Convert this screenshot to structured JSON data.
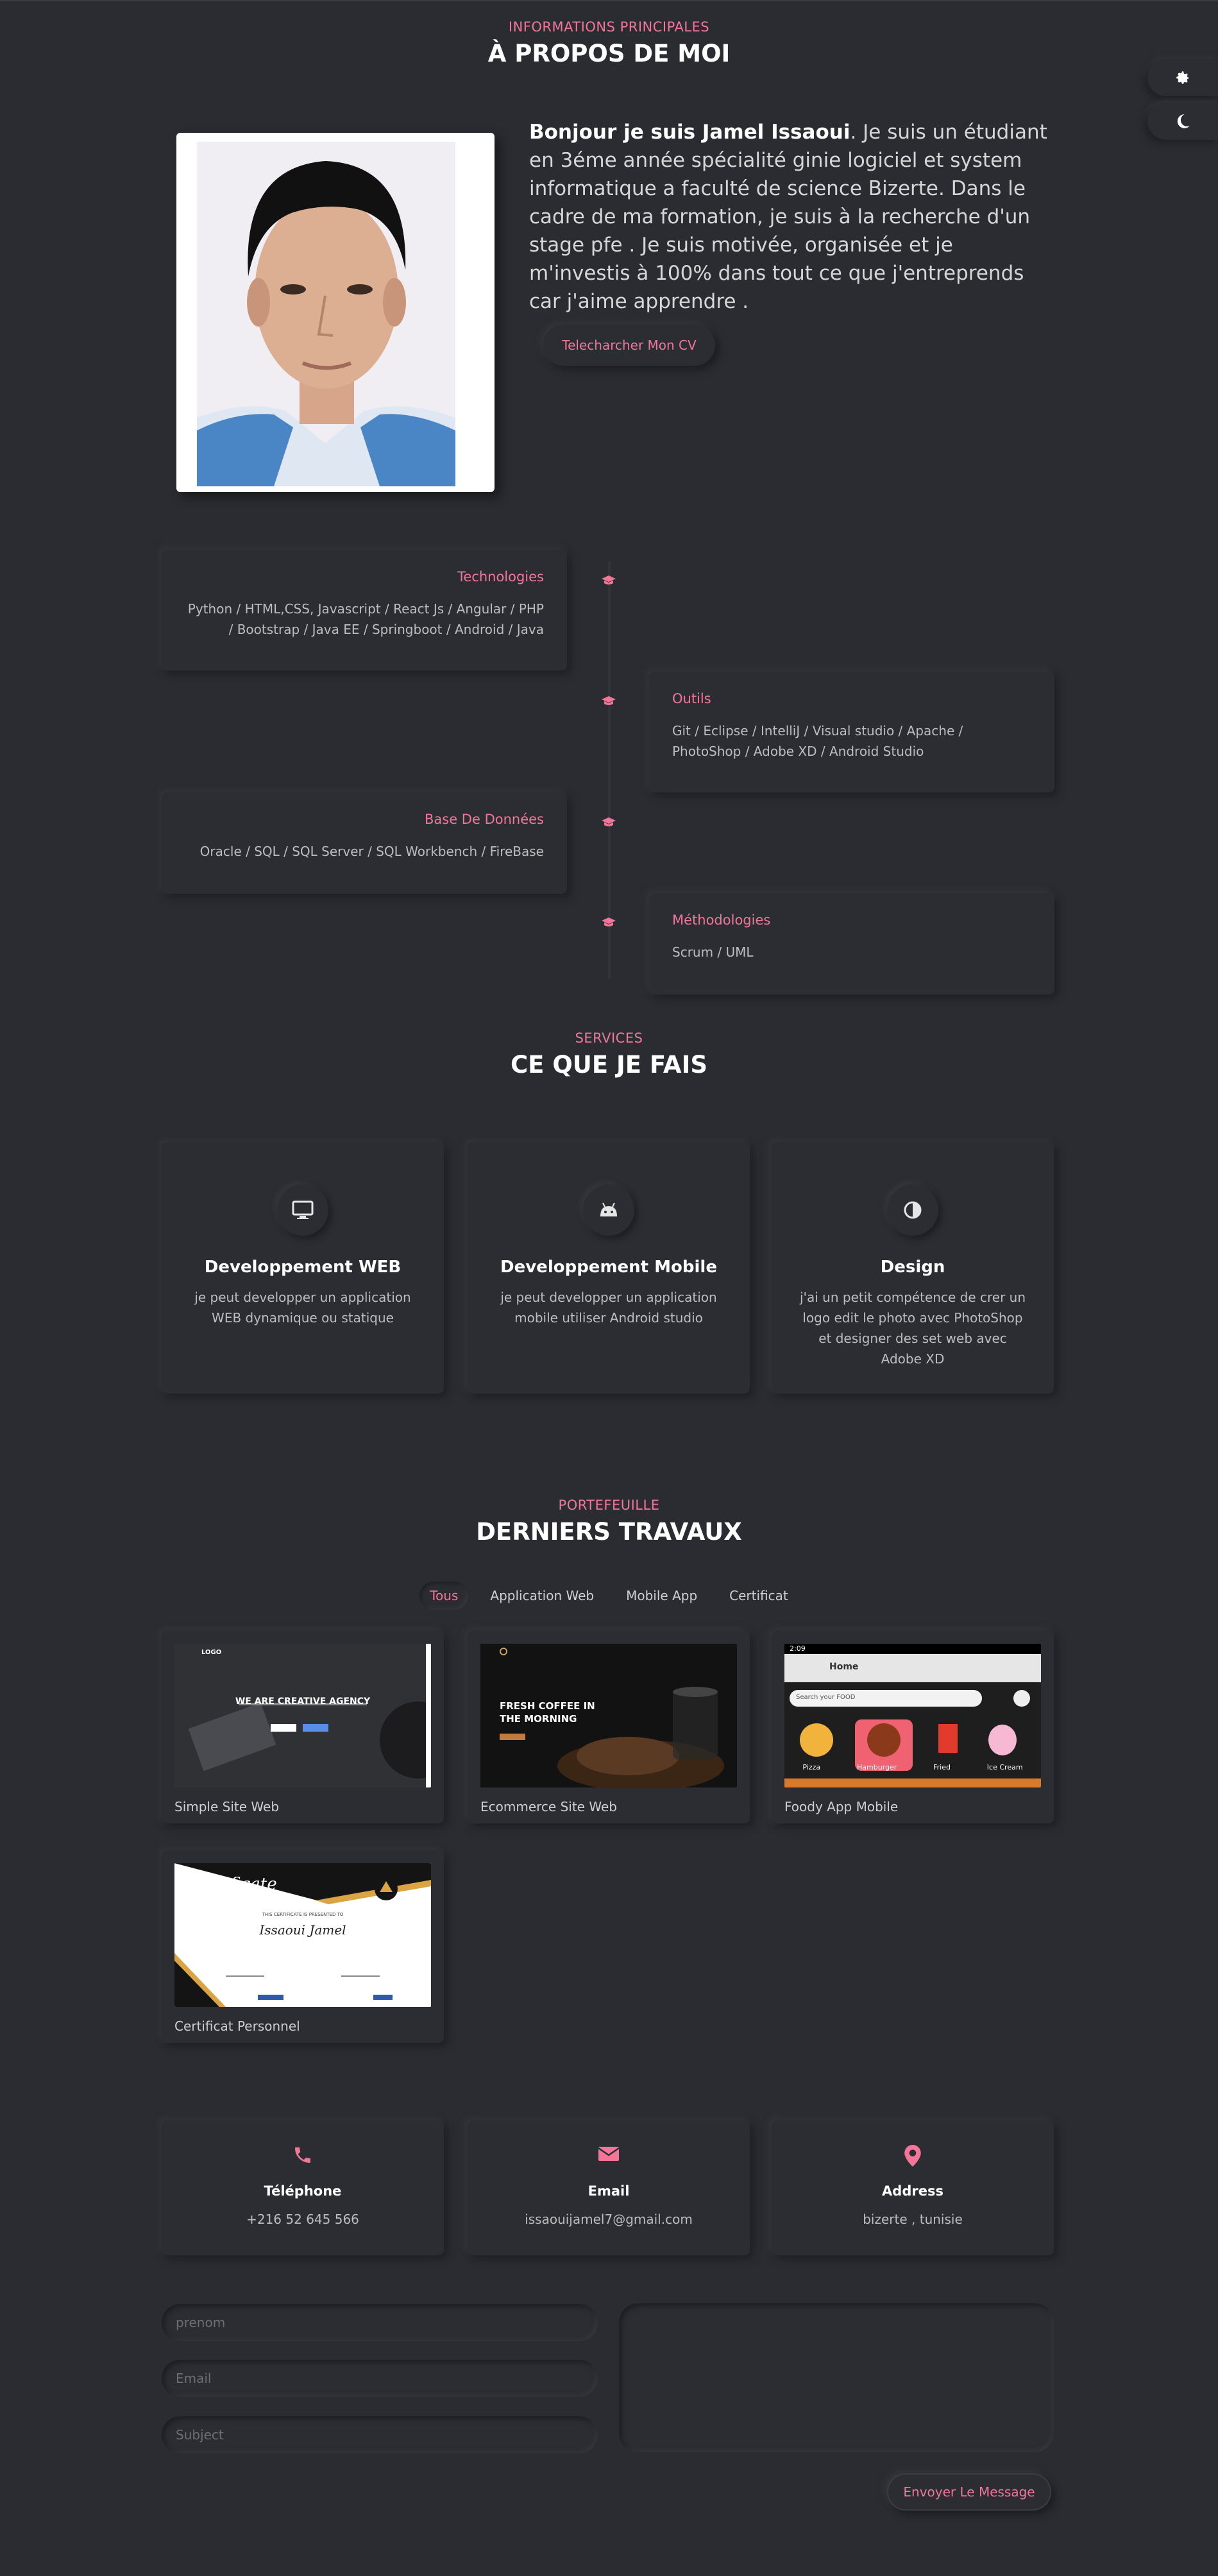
{
  "colors": {
    "accent": "#f27698",
    "background": "#2a2c31"
  },
  "side_buttons": {
    "settings_icon": "gear-icon",
    "theme_icon": "moon-icon"
  },
  "about": {
    "subtitle": "INFORMATIONS PRINCIPALES",
    "title": "À PROPOS DE MOI",
    "intro_bold": "Bonjour je suis Jamel Issaoui",
    "intro_rest": ". Je suis un étudiant en 3éme année spécialité ginie logiciel et system informatique a faculté de science Bizerte. Dans le cadre de ma formation, je suis à la recherche d'un stage pfe . Je suis motivée, organisée et je m'investis à 100% dans tout ce que j'entreprends car j'aime apprendre .",
    "cv_button": "Telecharcher Mon CV"
  },
  "skills": [
    {
      "title": "Technologies",
      "text": "Python / HTML,CSS, Javascript / React Js / Angular / PHP / Bootstrap / Java EE / Springboot / Android / Java"
    },
    {
      "title": "Outils",
      "text": "Git / Eclipse / IntelliJ / Visual studio / Apache / PhotoShop / Adobe XD / Android Studio"
    },
    {
      "title": "Base De Données",
      "text": "Oracle / SQL / SQL Server / SQL Workbench / FireBase"
    },
    {
      "title": "Méthodologies",
      "text": "Scrum / UML"
    }
  ],
  "services": {
    "subtitle": "SERVICES",
    "title": "CE QUE JE FAIS",
    "items": [
      {
        "title": "Developpement WEB",
        "text": "je peut developper un application WEB dynamique ou statique",
        "icon": "monitor-icon"
      },
      {
        "title": "Developpement Mobile",
        "text": "je peut developper un application mobile utiliser Android studio",
        "icon": "android-icon"
      },
      {
        "title": "Design",
        "text": "j'ai un petit compétence de crer un logo edit le photo avec PhotoShop et designer des set web avec Adobe XD",
        "icon": "contrast-icon"
      }
    ]
  },
  "portfolio": {
    "subtitle": "PORTEFEUILLE",
    "title": "DERNIERS TRAVAUX",
    "filters": [
      "Tous",
      "Application Web",
      "Mobile App",
      "Certificat"
    ],
    "works": [
      {
        "label": "Simple Site Web",
        "thumb": {
          "logo": "LOGO",
          "headline": "WE ARE CREATIVE AGENCY"
        }
      },
      {
        "label": "Ecommerce Site Web",
        "thumb": {
          "headline_1": "FRESH COFFEE IN",
          "headline_2": "THE MORNING"
        }
      },
      {
        "label": "Foody App Mobile",
        "thumb": {
          "time": "2:09",
          "bar_title": "Home",
          "search": "Search your FOOD",
          "categories": [
            "Pizza",
            "Hamburger",
            "Fried",
            "Ice Cream"
          ]
        }
      },
      {
        "label": "Certificat Personnel",
        "thumb": {
          "heading": "Certificate",
          "line": "THIS CERTIFICATE IS PRESENTED TO",
          "name": "Issaoui Jamel"
        }
      }
    ]
  },
  "contact": {
    "items": [
      {
        "title": "Téléphone",
        "value": "+216 52 645 566",
        "icon": "phone-icon"
      },
      {
        "title": "Email",
        "value": "issaouijamel7@gmail.com",
        "icon": "envelope-icon"
      },
      {
        "title": "Address",
        "value": "bizerte , tunisie",
        "icon": "map-pin-icon"
      }
    ],
    "form": {
      "name_placeholder": "prenom",
      "email_placeholder": "Email",
      "subject_placeholder": "Subject",
      "send_button": "Envoyer Le Message"
    }
  }
}
